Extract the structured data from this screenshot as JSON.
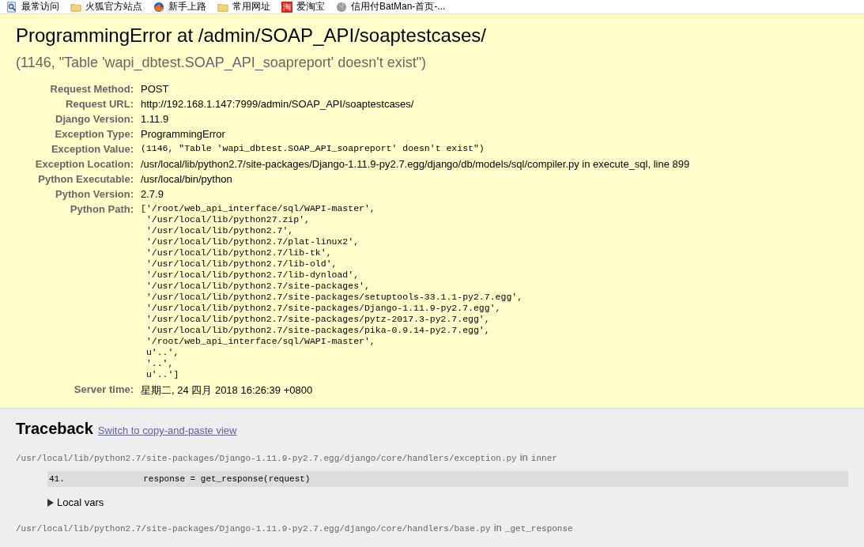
{
  "bookmarks": [
    {
      "label": "最常访问",
      "kind": "page"
    },
    {
      "label": "火狐官方站点",
      "kind": "folder"
    },
    {
      "label": "新手上路",
      "kind": "firefox"
    },
    {
      "label": "常用网址",
      "kind": "folder"
    },
    {
      "label": "爱淘宝",
      "kind": "badge",
      "icon_text": "淘"
    },
    {
      "label": "信用付BatMan-首页-...",
      "kind": "globe"
    }
  ],
  "summary": {
    "title": "ProgrammingError at /admin/SOAP_API/soaptestcases/",
    "subtitle": "(1146, \"Table 'wapi_dbtest.SOAP_API_soapreport' doesn't exist\")",
    "meta": [
      {
        "label": "Request Method:",
        "value": "POST",
        "kind": "text"
      },
      {
        "label": "Request URL:",
        "value": "http://192.168.1.147:7999/admin/SOAP_API/soaptestcases/",
        "kind": "text"
      },
      {
        "label": "Django Version:",
        "value": "1.11.9",
        "kind": "text"
      },
      {
        "label": "Exception Type:",
        "value": "ProgrammingError",
        "kind": "text"
      },
      {
        "label": "Exception Value:",
        "value": "(1146, \"Table 'wapi_dbtest.SOAP_API_soapreport' doesn't exist\")",
        "kind": "code"
      },
      {
        "label": "Exception Location:",
        "value": "/usr/local/lib/python2.7/site-packages/Django-1.11.9-py2.7.egg/django/db/models/sql/compiler.py in execute_sql, line 899",
        "kind": "text"
      },
      {
        "label": "Python Executable:",
        "value": "/usr/local/bin/python",
        "kind": "text"
      },
      {
        "label": "Python Version:",
        "value": "2.7.9",
        "kind": "text"
      },
      {
        "label": "Python Path:",
        "kind": "lines",
        "lines": [
          "['/root/web_api_interface/sql/WAPI-master',",
          " '/usr/local/lib/python27.zip',",
          " '/usr/local/lib/python2.7',",
          " '/usr/local/lib/python2.7/plat-linux2',",
          " '/usr/local/lib/python2.7/lib-tk',",
          " '/usr/local/lib/python2.7/lib-old',",
          " '/usr/local/lib/python2.7/lib-dynload',",
          " '/usr/local/lib/python2.7/site-packages',",
          " '/usr/local/lib/python2.7/site-packages/setuptools-33.1.1-py2.7.egg',",
          " '/usr/local/lib/python2.7/site-packages/Django-1.11.9-py2.7.egg',",
          " '/usr/local/lib/python2.7/site-packages/pytz-2017.3-py2.7.egg',",
          " '/usr/local/lib/python2.7/site-packages/pika-0.9.14-py2.7.egg',",
          " '/root/web_api_interface/sql/WAPI-master',",
          " u'..',",
          " '..',",
          " u'..']"
        ]
      },
      {
        "label": "Server time:",
        "value": "星期二, 24 四月 2018 16:26:39 +0800",
        "kind": "text"
      }
    ]
  },
  "traceback": {
    "title": "Traceback",
    "link": "Switch to copy-and-paste view",
    "frames": [
      {
        "file": "/usr/local/lib/python2.7/site-packages/Django-1.11.9-py2.7.egg/django/core/handlers/exception.py",
        "in": "in",
        "func": "inner",
        "line_no": "41.",
        "code": "            response = get_response(request)",
        "vars_label": "Local vars",
        "expanded": false
      },
      {
        "file": "/usr/local/lib/python2.7/site-packages/Django-1.11.9-py2.7.egg/django/core/handlers/base.py",
        "in": "in",
        "func": "_get_response"
      }
    ]
  }
}
